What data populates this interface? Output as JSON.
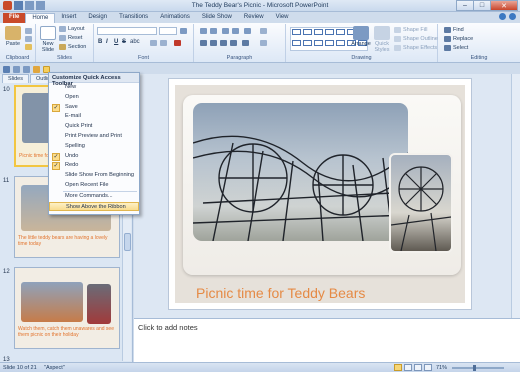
{
  "window": {
    "title": "The Teddy Bear's Picnic - Microsoft PowerPoint",
    "buttons": [
      "–",
      "□",
      "✕"
    ]
  },
  "ribbon_tabs": [
    "File",
    "Home",
    "Insert",
    "Design",
    "Transitions",
    "Animations",
    "Slide Show",
    "Review",
    "View"
  ],
  "ribbon": {
    "clipboard": {
      "paste": "Paste",
      "label": "Clipboard"
    },
    "slides": {
      "new_slide": "New Slide",
      "layout": "Layout",
      "reset": "Reset",
      "section": "Section",
      "label": "Slides"
    },
    "font": {
      "bold": "B",
      "italic": "I",
      "underline": "U",
      "strike": "S",
      "shadow": "abc",
      "label": "Font"
    },
    "paragraph": {
      "label": "Paragraph"
    },
    "drawing": {
      "arrange": "Arrange",
      "quick_styles": "Quick Styles",
      "shape_fill": "Shape Fill",
      "shape_outline": "Shape Outline",
      "shape_effects": "Shape Effects",
      "label": "Drawing"
    },
    "editing": {
      "find": "Find",
      "replace": "Replace",
      "select": "Select",
      "label": "Editing"
    }
  },
  "left_pane": {
    "tabs": [
      "Slides",
      "Outline"
    ],
    "slides": [
      {
        "num": "10",
        "caption": "Picnic time for Teddy Bears"
      },
      {
        "num": "11",
        "caption": "The little teddy bears are having a lovely time today"
      },
      {
        "num": "12",
        "caption": "Watch them, catch them unawares and see them picnic on their holiday"
      },
      {
        "num": "13",
        "caption": ""
      }
    ]
  },
  "qat_menu": {
    "title": "Customize Quick Access Toolbar",
    "items": [
      {
        "label": "New",
        "checked": false
      },
      {
        "label": "Open",
        "checked": false
      },
      {
        "label": "Save",
        "checked": true
      },
      {
        "label": "E-mail",
        "checked": false
      },
      {
        "label": "Quick Print",
        "checked": false
      },
      {
        "label": "Print Preview and Print",
        "checked": false
      },
      {
        "label": "Spelling",
        "checked": false
      },
      {
        "label": "Undo",
        "checked": true
      },
      {
        "label": "Redo",
        "checked": true
      },
      {
        "label": "Slide Show From Beginning",
        "checked": false
      },
      {
        "label": "Open Recent File",
        "checked": false
      }
    ],
    "more_commands": "More Commands...",
    "show_above": "Show Above the Ribbon"
  },
  "slide": {
    "title": "Picnic time for Teddy Bears"
  },
  "notes": {
    "placeholder": "Click to add notes"
  },
  "status": {
    "slide_info": "Slide 10 of 21",
    "theme": "\"Aspect\"",
    "zoom": "71%"
  },
  "colors": {
    "file_tab": "#c94a2a",
    "title_orange": "#e58a45",
    "menu_highlight": "#f9dc8e"
  }
}
